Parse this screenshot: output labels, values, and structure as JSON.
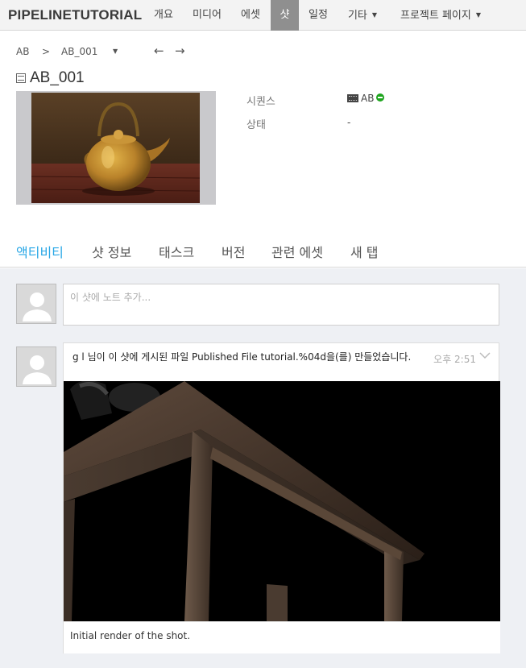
{
  "nav": {
    "brand": "PIPELINETUTORIAL",
    "items": [
      {
        "label": "개요"
      },
      {
        "label": "미디어"
      },
      {
        "label": "에셋"
      },
      {
        "label": "샷"
      },
      {
        "label": "일정"
      },
      {
        "label": "기타"
      },
      {
        "label": "프로젝트 페이지"
      }
    ],
    "active_color": "#8f8f8f"
  },
  "breadcrumb": {
    "root": "AB",
    "separator": ">",
    "current": "AB_001"
  },
  "shot": {
    "title": "AB_001",
    "fields": [
      {
        "label": "시퀀스",
        "value": "AB"
      },
      {
        "label": "상태",
        "value": "-"
      }
    ],
    "status_color": "#1ea51e"
  },
  "tabs": [
    {
      "label": "액티비티"
    },
    {
      "label": "샷 정보"
    },
    {
      "label": "태스크"
    },
    {
      "label": "버전"
    },
    {
      "label": "관련 에셋"
    },
    {
      "label": "새 탭"
    }
  ],
  "accent_color": "#28a7e6",
  "activity": {
    "note_placeholder": "이 샷에 노트 추가...",
    "posts": [
      {
        "text": "g l 님이 이 샷에 게시된 파일 Published File tutorial.%04d을(를) 만들었습니다.",
        "time": "오후 2:51",
        "caption": "Initial render of the shot."
      }
    ]
  }
}
